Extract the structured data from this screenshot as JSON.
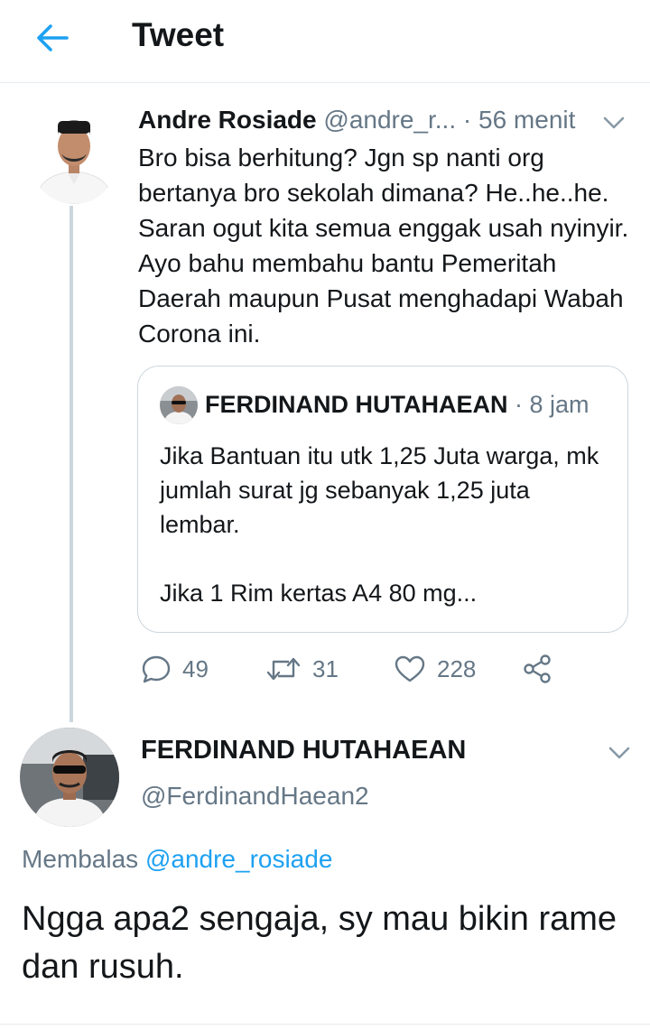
{
  "header": {
    "title": "Tweet",
    "back_icon": "arrow-left-icon",
    "accent": "#1da1f2"
  },
  "tweet1": {
    "name": "Andre Rosiade",
    "handle": "@andre_r...",
    "time": "· 56 menit",
    "body": "Bro bisa berhitung? Jgn sp nanti org bertanya bro sekolah dimana? He..he..he. Saran ogut kita semua enggak usah nyinyir. Ayo bahu membahu bantu Pemeritah Daerah maupun Pusat menghadapi Wabah Corona ini.",
    "quote": {
      "name": "FERDINAND HUTAHAEAN",
      "time": "· 8 jam",
      "body": "Jika Bantuan itu utk 1,25 Juta warga, mk jumlah surat jg sebanyak 1,25 juta lembar.\n\nJika 1 Rim kertas A4 80 mg..."
    },
    "actions": {
      "replies": "49",
      "retweets": "31",
      "likes": "228"
    }
  },
  "tweet2": {
    "name": "FERDINAND HUTAHAEAN",
    "handle": "@FerdinandHaean2",
    "replying_prefix": "Membalas",
    "replying_to": "@andre_rosiade",
    "body": "Ngga apa2 sengaja, sy mau bikin rame dan rusuh."
  },
  "colors": {
    "text": "#14171a",
    "secondary": "#657786",
    "border": "#ccd6dd",
    "divider": "#e6ecf0"
  }
}
